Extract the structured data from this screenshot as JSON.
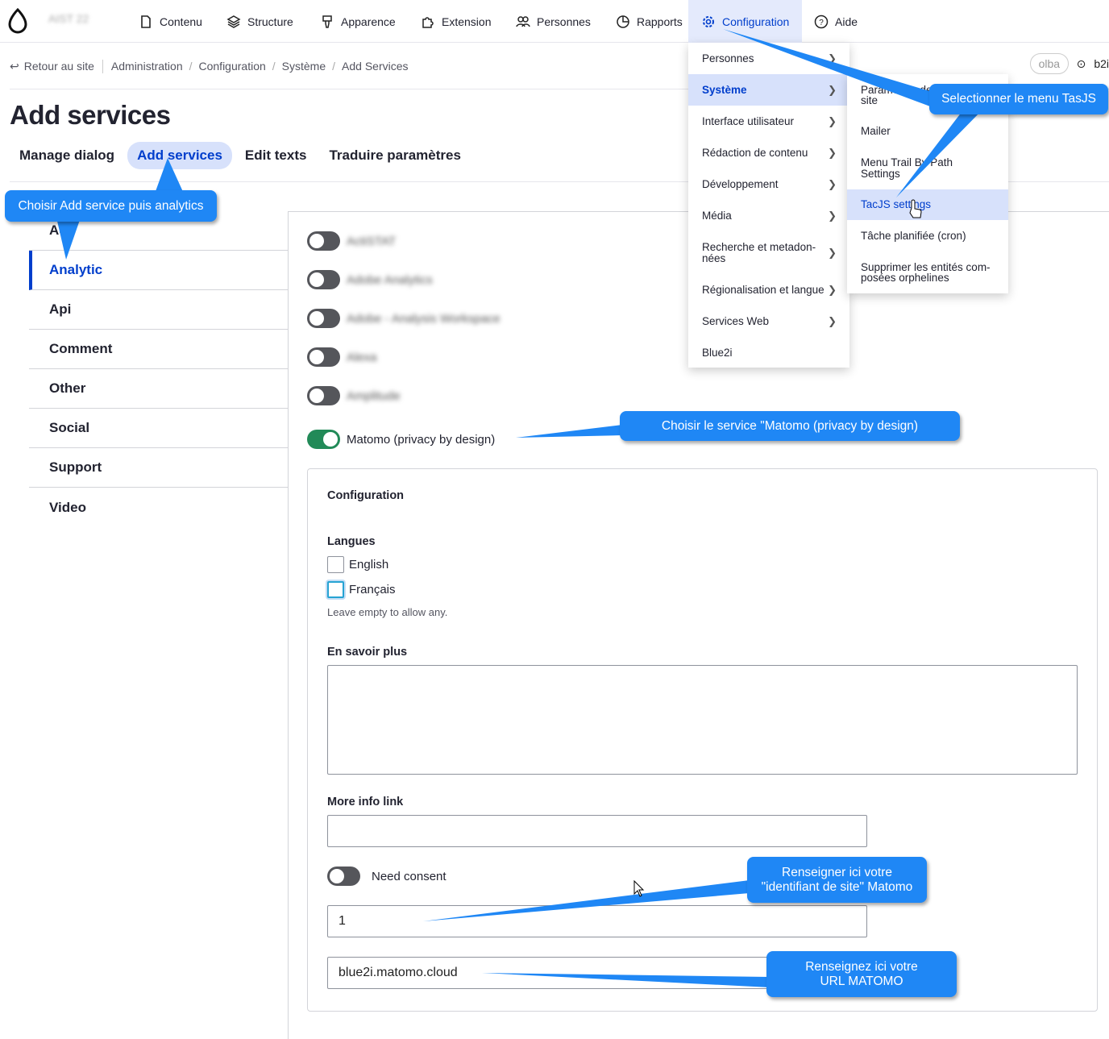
{
  "toolbar": {
    "site_name": "AIST 22",
    "items": [
      "Contenu",
      "Structure",
      "Apparence",
      "Extension",
      "Personnes",
      "Rapports",
      "Configuration",
      "Aide"
    ],
    "user": "b2i",
    "pill_text": "olba"
  },
  "breadcrumb": {
    "back": "Retour au site",
    "items": [
      "Administration",
      "Configuration",
      "Système",
      "Add Services"
    ]
  },
  "page": {
    "title": "Add services",
    "tabs": [
      "Manage dialog",
      "Add services",
      "Edit texts",
      "Traduire paramètres"
    ]
  },
  "vertical_tabs": {
    "first_partial": "Ads",
    "items": [
      "Analytic",
      "Api",
      "Comment",
      "Other",
      "Social",
      "Support",
      "Video"
    ]
  },
  "services": {
    "blurred": [
      "ActiSTAT",
      "Adobe Analytics",
      "Adobe - Analysis Workspace",
      "Alexa",
      "Amplitude"
    ],
    "enabled": "Matomo (privacy by design)"
  },
  "config": {
    "legend": "Configuration",
    "langues_label": "Langues",
    "languages": [
      "English",
      "Français"
    ],
    "langues_desc": "Leave empty to allow any.",
    "learn_more_label": "En savoir plus",
    "more_info_label": "More info link",
    "need_consent_label": "Need consent",
    "site_id_value": "1",
    "url_value": "blue2i.matomo.cloud"
  },
  "menu_config": {
    "items": [
      "Personnes",
      "Système",
      "Interface utilisateur",
      "Rédaction de contenu",
      "Développement",
      "Média",
      "Recherche et metadon-\nnées",
      "Régionalisation et langue",
      "Services Web",
      "Blue2i"
    ]
  },
  "menu_systeme": {
    "items": [
      "Paramètres de base du\nsite",
      "Mailer",
      "Menu Trail By Path\nSettings",
      "TacJS settings",
      "Tâche planifiée (cron)",
      "Supprimer les entités com-\nposées orphelines"
    ]
  },
  "callouts": {
    "tasjs": "Selectionner le menu TasJS",
    "add_service": "Choisir Add service puis analytics",
    "matomo": "Choisir le service \"Matomo (privacy by design)",
    "site_id": "Renseigner ici votre\n\"identifiant de site\" Matomo",
    "url": "Renseignez ici votre\nURL MATOMO"
  },
  "colors": {
    "accent": "#003ecc",
    "callout": "#1f87f5",
    "toggle_on": "#228a58"
  }
}
